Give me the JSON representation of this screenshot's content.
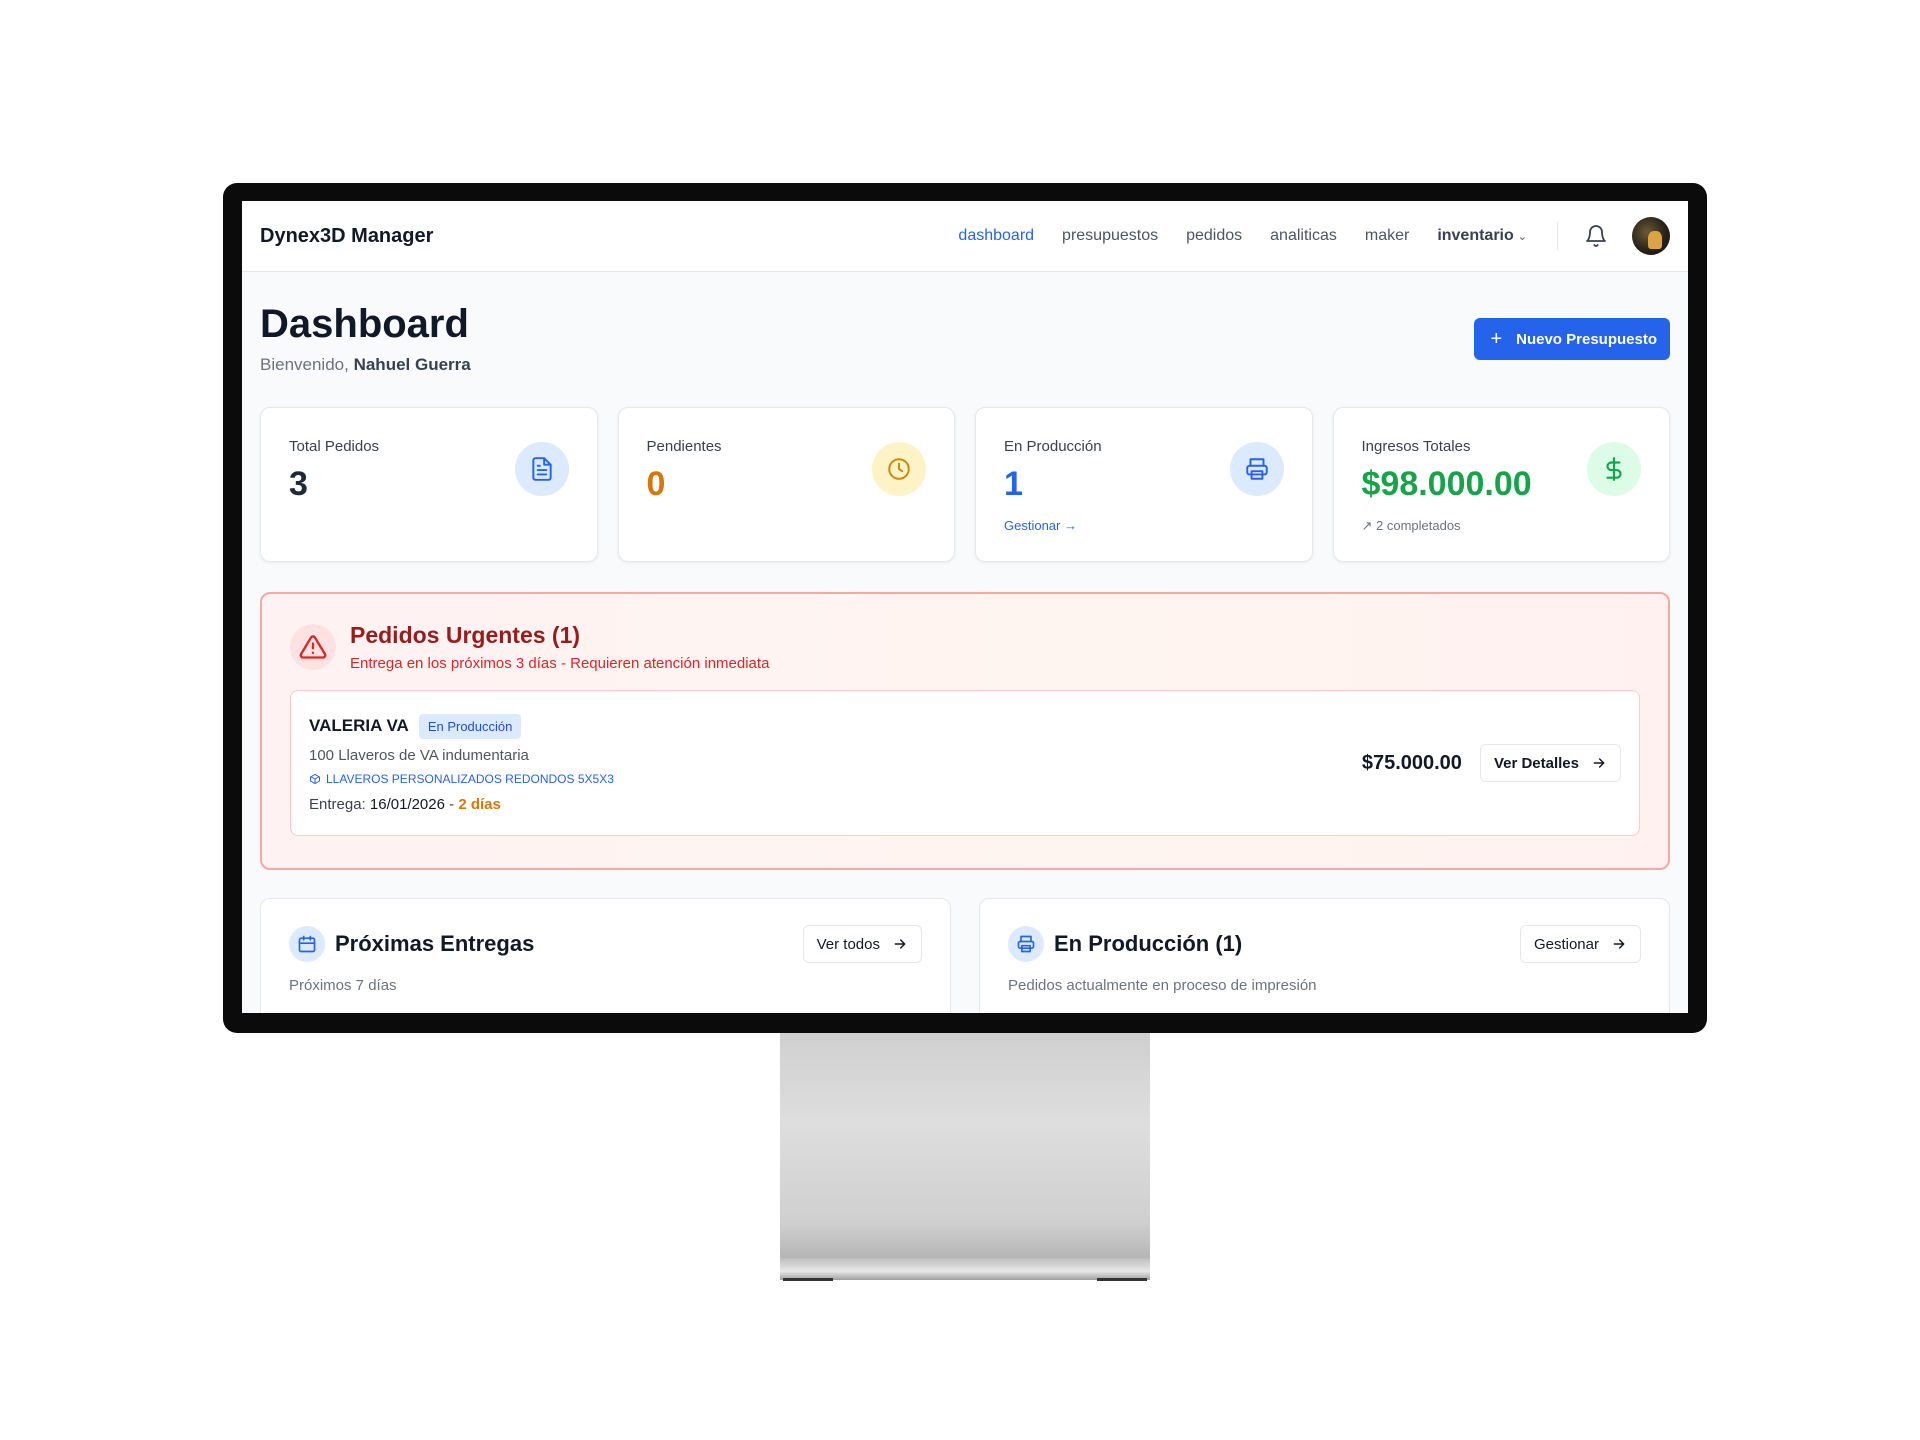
{
  "app": {
    "brand": "Dynex3D Manager"
  },
  "nav": {
    "items": [
      {
        "label": "dashboard",
        "active": true
      },
      {
        "label": "presupuestos"
      },
      {
        "label": "pedidos"
      },
      {
        "label": "analiticas"
      },
      {
        "label": "maker"
      }
    ],
    "dropdown_label": "inventario",
    "dropdown_icon": "chevron-down-icon",
    "bell_icon": "bell-icon",
    "avatar": "user-avatar"
  },
  "header": {
    "title": "Dashboard",
    "welcome_prefix": "Bienvenido,",
    "user_name": "Nahuel Guerra",
    "new_button_label": "Nuevo Presupuesto"
  },
  "stats": [
    {
      "label": "Total Pedidos",
      "value": "3",
      "color": "#1f2937",
      "icon": "document-icon",
      "icon_bg": "#dbeafe",
      "icon_color": "#2563eb"
    },
    {
      "label": "Pendientes",
      "value": "0",
      "color": "#d97706",
      "icon": "clock-icon",
      "icon_bg": "#fef3c7",
      "icon_color": "#ca8a04"
    },
    {
      "label": "En Producción",
      "value": "1",
      "color": "#2563eb",
      "icon": "printer-icon",
      "icon_bg": "#dbeafe",
      "icon_color": "#2563eb",
      "link": "Gestionar →"
    },
    {
      "label": "Ingresos Totales",
      "value": "$98.000.00",
      "color": "#16a34a",
      "icon": "dollar-icon",
      "icon_bg": "#dcfce7",
      "icon_color": "#16a34a",
      "sub": "↗ 2 completados"
    }
  ],
  "urgent": {
    "title": "Pedidos Urgentes (1)",
    "subtitle": "Entrega en los próximos 3 días - Requieren atención inmediata",
    "icon": "warning-icon",
    "order": {
      "client": "VALERIA VA",
      "status": "En Producción",
      "description": "100 Llaveros de VA indumentaria",
      "product": "LLAVEROS PERSONALIZADOS REDONDOS 5X5X3",
      "delivery_label": "Entrega:",
      "delivery_date": "16/01/2026",
      "delivery_sep": "-",
      "days_left": "2 días",
      "price": "$75.000.00",
      "details_button": "Ver Detalles"
    }
  },
  "panels": [
    {
      "title": "Próximas Entregas",
      "subtitle": "Próximos 7 días",
      "button": "Ver todos",
      "icon": "calendar-icon"
    },
    {
      "title": "En Producción (1)",
      "subtitle": "Pedidos actualmente en proceso de impresión",
      "button": "Gestionar",
      "icon": "printer-icon"
    }
  ],
  "colors": {
    "primary": "#2563eb",
    "urgent": "#991b1b",
    "urgent_border": "#fca5a5"
  }
}
